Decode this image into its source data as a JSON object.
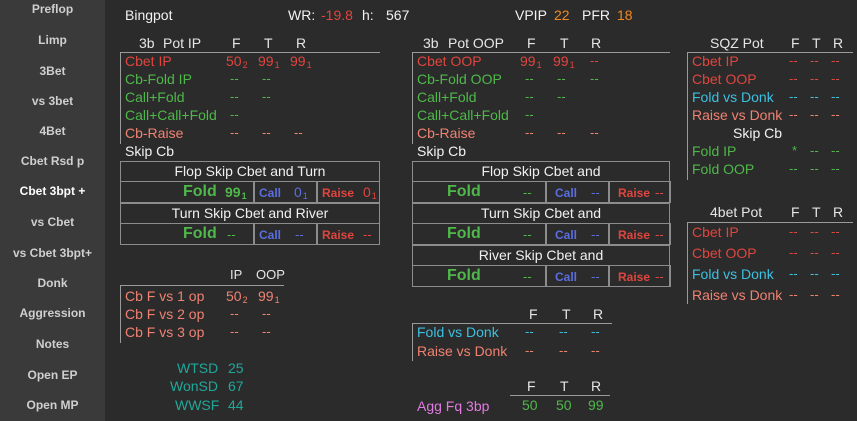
{
  "sidebar": {
    "items": [
      {
        "label": "Preflop"
      },
      {
        "label": "Limp"
      },
      {
        "label": "3Bet"
      },
      {
        "label": "vs 3bet"
      },
      {
        "label": "4Bet"
      },
      {
        "label": "Cbet Rsd p"
      },
      {
        "label": "Cbet 3bpt +"
      },
      {
        "label": "vs Cbet"
      },
      {
        "label": "vs Cbet 3bpt+"
      },
      {
        "label": "Donk"
      },
      {
        "label": "Aggression"
      },
      {
        "label": "Notes"
      },
      {
        "label": "Open EP"
      },
      {
        "label": "Open MP"
      }
    ],
    "active_index": 6
  },
  "header": {
    "player": "Bingpot",
    "wr_label": "WR:",
    "wr_value": "-19.8",
    "h_label": "h:",
    "h_value": "567",
    "vpip_label": "VPIP",
    "vpip_value": "22",
    "pfr_label": "PFR",
    "pfr_value": "18"
  },
  "colors": {
    "background": "#2b2b2b",
    "sidebar": "#3a3a3a",
    "red": "#e0453e",
    "salmon": "#f08272",
    "green": "#4fb84a",
    "cyan": "#3cc0e0",
    "teal": "#20a89a",
    "orange": "#f28a1e",
    "magenta": "#e07ae0",
    "blue": "#5a6ee0"
  },
  "ip": {
    "title_a": "3b",
    "title_b": "Pot IP",
    "cols": [
      "F",
      "T",
      "R"
    ],
    "rows": [
      {
        "label": "Cbet IP",
        "f": "50",
        "f_sub": "2",
        "t": "99",
        "t_sub": "1",
        "r": "99",
        "r_sub": "1"
      },
      {
        "label": "Cb-Fold IP",
        "f": "--",
        "t": "--",
        "r": ""
      },
      {
        "label": "Call+Fold",
        "f": "--",
        "t": "--",
        "r": ""
      },
      {
        "label": "Call+Call+Fold",
        "f": "--",
        "t": "",
        "r": ""
      },
      {
        "label": "Cb-Raise",
        "f": "--",
        "t": "--",
        "r": "--"
      },
      {
        "label": "Skip Cb"
      }
    ],
    "box1": {
      "title": "Flop Skip Cbet and Turn",
      "fold_label": "Fold",
      "fold_val": "99",
      "fold_sub": "1",
      "call_label": "Call",
      "call_val": "0",
      "call_sub": "1",
      "raise_label": "Raise",
      "raise_val": "0",
      "raise_sub": "1"
    },
    "box2": {
      "title": "Turn Skip Cbet and River",
      "fold_label": "Fold",
      "fold_val": "--",
      "call_label": "Call",
      "call_val": "--",
      "raise_label": "Raise",
      "raise_val": "--"
    }
  },
  "oop": {
    "title_a": "3b",
    "title_b": "Pot OOP",
    "cols": [
      "F",
      "T",
      "R"
    ],
    "rows": [
      {
        "label": "Cbet OOP",
        "f": "99",
        "f_sub": "1",
        "t": "99",
        "t_sub": "1",
        "r": "--"
      },
      {
        "label": "Cb-Fold OOP",
        "f": "--",
        "t": "--",
        "r": "--"
      },
      {
        "label": "Call+Fold",
        "f": "--",
        "t": "--",
        "r": ""
      },
      {
        "label": "Call+Call+Fold",
        "f": "--",
        "t": "",
        "r": ""
      },
      {
        "label": "Cb-Raise",
        "f": "--",
        "t": "--",
        "r": "--"
      },
      {
        "label": "Skip Cb"
      }
    ],
    "box1": {
      "title": "Flop Skip Cbet and",
      "fold_label": "Fold",
      "fold_val": "--",
      "call_label": "Call",
      "call_val": "--",
      "raise_label": "Raise",
      "raise_val": "--"
    },
    "box2": {
      "title": "Turn Skip Cbet and",
      "fold_label": "Fold",
      "fold_val": "--",
      "call_label": "Call",
      "call_val": "--",
      "raise_label": "Raise",
      "raise_val": "--"
    },
    "box3": {
      "title": "River Skip Cbet and",
      "fold_label": "Fold",
      "fold_val": "--",
      "call_label": "Call",
      "call_val": "--",
      "raise_label": "Raise",
      "raise_val": "--"
    }
  },
  "sqz": {
    "title": "SQZ Pot",
    "cols": [
      "F",
      "T",
      "R"
    ],
    "rows": [
      {
        "label": "Cbet IP",
        "f": "--",
        "t": "--",
        "r": "--"
      },
      {
        "label": "Cbet OOP",
        "f": "--",
        "t": "--",
        "r": "--"
      },
      {
        "label": "Fold vs Donk",
        "f": "--",
        "t": "--",
        "r": "--"
      },
      {
        "label": "Raise vs Donk",
        "f": "--",
        "t": "--",
        "r": "--"
      },
      {
        "label": "Skip Cb"
      },
      {
        "label": "Fold IP",
        "f": "*",
        "t": "--",
        "r": "--"
      },
      {
        "label": "Fold OOP",
        "f": "--",
        "t": "--",
        "r": "--"
      }
    ]
  },
  "fourbet": {
    "title": "4bet Pot",
    "cols": [
      "F",
      "T",
      "R"
    ],
    "rows": [
      {
        "label": "Cbet IP",
        "f": "--",
        "t": "--",
        "r": "--"
      },
      {
        "label": "Cbet OOP",
        "f": "--",
        "t": "--",
        "r": "--"
      },
      {
        "label": "Fold vs Donk",
        "f": "--",
        "t": "--",
        "r": "--"
      },
      {
        "label": "Raise vs Donk",
        "f": "--",
        "t": "--",
        "r": "--"
      }
    ]
  },
  "cbf": {
    "cols": [
      "IP",
      "OOP"
    ],
    "rows": [
      {
        "label": "Cb F vs 1 op",
        "ip": "50",
        "ip_sub": "2",
        "oop": "99",
        "oop_sub": "1"
      },
      {
        "label": "Cb F vs 2 op",
        "ip": "--",
        "oop": "--"
      },
      {
        "label": "Cb F vs 3 op",
        "ip": "--",
        "oop": "--"
      }
    ]
  },
  "showdown": {
    "rows": [
      {
        "label": "WTSD",
        "value": "25"
      },
      {
        "label": "WonSD",
        "value": "67"
      },
      {
        "label": "WWSF",
        "value": "44"
      }
    ]
  },
  "donk": {
    "cols": [
      "F",
      "T",
      "R"
    ],
    "rows": [
      {
        "label": "Fold vs Donk",
        "f": "--",
        "t": "--",
        "r": "--"
      },
      {
        "label": "Raise vs Donk",
        "f": "--",
        "t": "--",
        "r": "--"
      }
    ]
  },
  "agg": {
    "cols": [
      "F",
      "T",
      "R"
    ],
    "label": "Agg Fq 3bp",
    "f": "50",
    "t": "50",
    "r": "99"
  }
}
